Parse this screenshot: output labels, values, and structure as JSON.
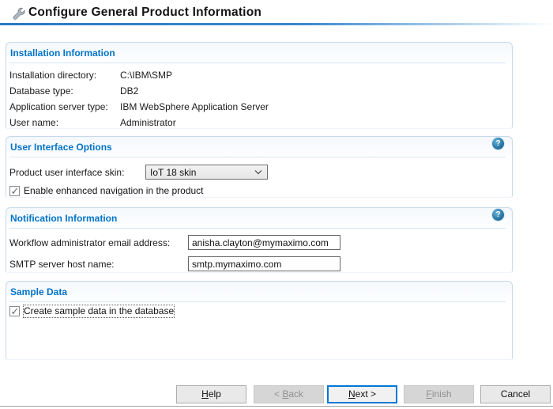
{
  "window": {
    "title": "Configure General Product Information",
    "title_icon": "wrench-icon"
  },
  "sections": {
    "installation": {
      "title": "Installation Information",
      "fields": [
        {
          "label": "Installation directory:",
          "value": "C:\\IBM\\SMP"
        },
        {
          "label": "Database type:",
          "value": "DB2"
        },
        {
          "label": "Application server type:",
          "value": "IBM WebSphere Application Server"
        },
        {
          "label": "User name:",
          "value": "Administrator"
        }
      ]
    },
    "ui_options": {
      "title": "User Interface Options",
      "skin_label": "Product user interface skin:",
      "skin_value": "IoT 18 skin",
      "checkbox_label": "Enable enhanced navigation in the product",
      "checkbox_checked": true
    },
    "notification": {
      "title": "Notification Information",
      "email_label": "Workflow administrator email address:",
      "email_value": "anisha.clayton@mymaximo.com",
      "smtp_label": "SMTP server host name:",
      "smtp_value": "smtp.mymaximo.com"
    },
    "sample_data": {
      "title": "Sample Data",
      "checkbox_label": "Create sample data in the database",
      "checkbox_checked": true
    }
  },
  "icons": {
    "help_glyph": "?"
  },
  "footer": {
    "buttons": [
      {
        "id": "help",
        "label": "Help",
        "pre": "",
        "mnemonic": "H",
        "rest": "elp",
        "state": "enabled"
      },
      {
        "id": "back",
        "label": "< Back",
        "pre": "< ",
        "mnemonic": "B",
        "rest": "ack",
        "state": "disabled"
      },
      {
        "id": "next",
        "label": "Next >",
        "pre": "",
        "mnemonic": "N",
        "rest": "ext >",
        "state": "default"
      },
      {
        "id": "finish",
        "label": "Finish",
        "pre": "",
        "mnemonic": "F",
        "rest": "inish",
        "state": "disabled"
      },
      {
        "id": "cancel",
        "label": "Cancel",
        "pre": "Cancel",
        "mnemonic": "",
        "rest": "",
        "state": "enabled"
      }
    ]
  },
  "colors": {
    "section_title": "#0273C7",
    "header_rule": "#3C87CF",
    "focus_border": "#0078D7",
    "help_icon": "#1E6E9E"
  }
}
